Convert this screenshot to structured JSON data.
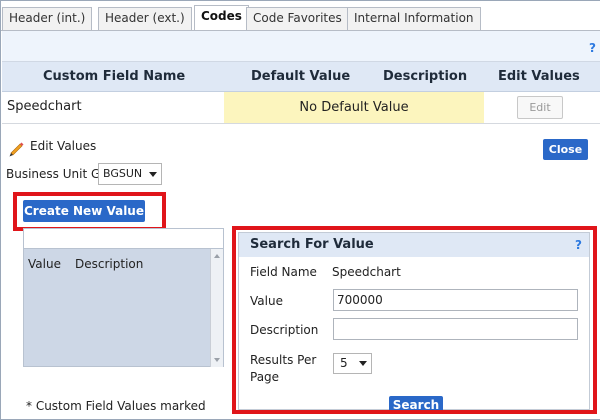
{
  "tabs": [
    {
      "label": "Header (int.)",
      "active": false
    },
    {
      "label": "Header (ext.)",
      "active": false
    },
    {
      "label": "Codes",
      "active": true
    },
    {
      "label": "Code Favorites",
      "active": false
    },
    {
      "label": "Internal Information",
      "active": false
    }
  ],
  "help_mark": "?",
  "table": {
    "headers": [
      "Custom Field Name",
      "Default Value",
      "Description",
      "Edit Values"
    ],
    "row": {
      "name": "Speedchart",
      "default_value": "No Default Value",
      "edit_label": "Edit"
    }
  },
  "edit_section": {
    "title": "Edit Values",
    "close_label": "Close",
    "business_unit_label": "Business Unit GL",
    "business_unit_value": "BGSUN",
    "create_button_label": "Create New Value",
    "list_headers": [
      "Value",
      "Description"
    ],
    "footnote": "* Custom Field Values marked"
  },
  "search_panel": {
    "title": "Search For Value",
    "help_mark": "?",
    "field_name_label": "Field Name",
    "field_name_value": "Speedchart",
    "value_label": "Value",
    "value_input": "700000",
    "description_label": "Description",
    "description_input": "",
    "results_label_line1": "Results Per",
    "results_label_line2": "Page",
    "results_value": "5",
    "search_button_label": "Search"
  },
  "colors": {
    "accent": "#2a68c8",
    "highlight_red": "#e0151a",
    "default_value_bg": "#fcf5be",
    "header_bg": "#dfe8f5"
  }
}
